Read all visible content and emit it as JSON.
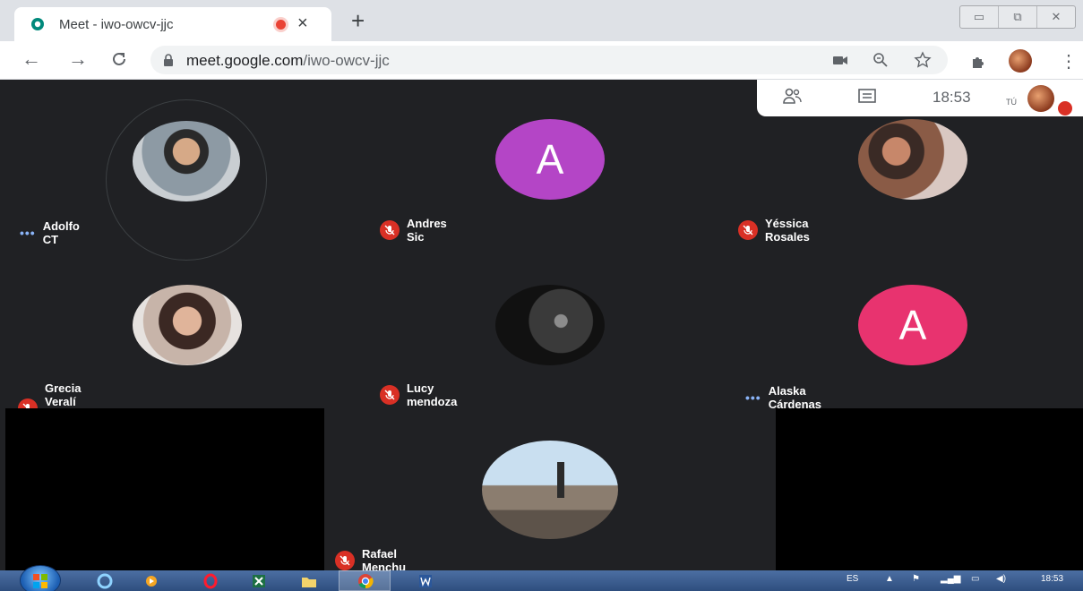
{
  "browser": {
    "tab_title": "Meet - iwo-owcv-jjc",
    "close_glyph": "×",
    "new_tab_glyph": "+",
    "url_host": "meet.google.com",
    "url_path": "/iwo-owcv-jjc",
    "window_controls": [
      "▭",
      "⧉",
      "✕"
    ]
  },
  "meet": {
    "clock": "18:53",
    "self_label": "TÚ",
    "participants": [
      {
        "name": "Adolfo CT",
        "status": "speaking",
        "avatar": "photo"
      },
      {
        "name": "Andres Sic",
        "status": "muted",
        "avatar": "letter",
        "letter": "A",
        "color": "#b445c6"
      },
      {
        "name": "Yéssica Rosales",
        "status": "muted",
        "avatar": "photo"
      },
      {
        "name": "Grecia Veralí Arévalo Barillas",
        "status": "muted",
        "avatar": "photo"
      },
      {
        "name": "Lucy mendoza",
        "status": "muted",
        "avatar": "photo"
      },
      {
        "name": "Alaska Cárdenas",
        "status": "speaking",
        "avatar": "letter",
        "letter": "A",
        "color": "#e8336f"
      },
      {
        "name": "Rafael Menchu",
        "status": "muted",
        "avatar": "photo"
      }
    ],
    "dots": "•••"
  },
  "taskbar": {
    "language": "ES",
    "time": "18:53"
  },
  "colors": {
    "stage_bg": "#202124",
    "muted_red": "#d93025",
    "speaking_dots": "#8ab4f8"
  }
}
